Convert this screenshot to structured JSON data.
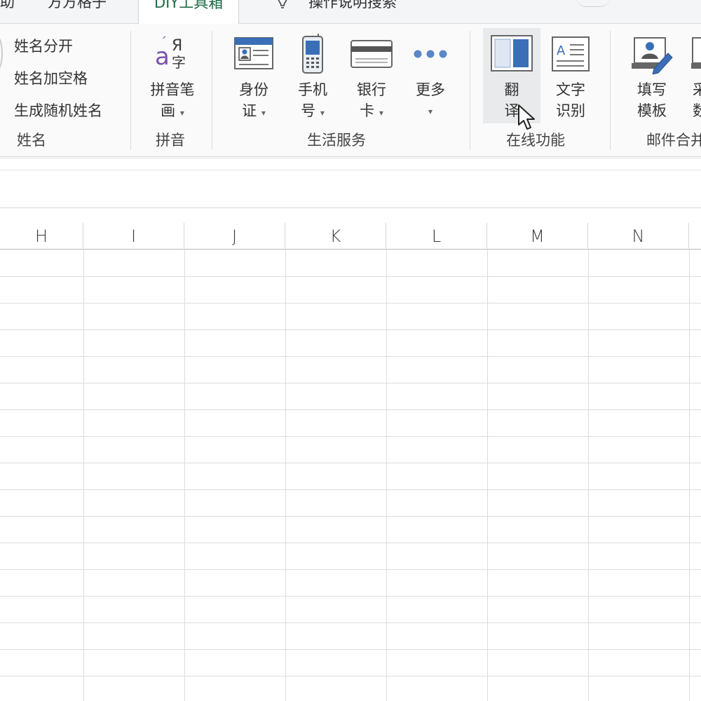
{
  "tabs": [
    {
      "label": "助"
    },
    {
      "label": "方方格子"
    },
    {
      "label": "DIY工具箱",
      "active": true
    },
    {
      "label": "操作说明搜索"
    }
  ],
  "ribbon": {
    "name_group": {
      "items": [
        "姓名分开",
        "姓名加空格",
        "生成随机姓名"
      ],
      "label": "姓名"
    },
    "pinyin_group": {
      "button_line1": "拼音笔",
      "button_line2": "画",
      "label": "拼音"
    },
    "life_group": {
      "id_card": {
        "line1": "身份",
        "line2": "证"
      },
      "phone": {
        "line1": "手机",
        "line2": "号"
      },
      "bank_card": {
        "line1": "银行",
        "line2": "卡"
      },
      "more": {
        "line1": "更多"
      },
      "label": "生活服务"
    },
    "online_group": {
      "translate": {
        "line1": "翻",
        "line2": "译"
      },
      "ocr": {
        "line1": "文字",
        "line2": "识别"
      },
      "label": "在线功能"
    },
    "mail_group": {
      "template": {
        "line1": "填写",
        "line2": "模板"
      },
      "partial": {
        "line1": "采",
        "line2": "数"
      },
      "label": "邮件合并"
    }
  },
  "columns": [
    "H",
    "I",
    "J",
    "K",
    "L",
    "M",
    "N"
  ],
  "colors": {
    "accent": "#1f6b46",
    "icon_blue": "#3a6fb7",
    "icon_purple": "#7a52a8",
    "more_dots": "#5b86c7"
  },
  "icons": {
    "pinyin": "pinyin-letter-icon",
    "id_card": "id-card-icon",
    "phone": "mobile-phone-icon",
    "bank_card": "bank-card-icon",
    "more": "more-dots-icon",
    "translate": "translate-book-icon",
    "ocr": "text-recognition-icon",
    "template": "fill-template-icon",
    "cursor": "mouse-pointer-icon"
  }
}
